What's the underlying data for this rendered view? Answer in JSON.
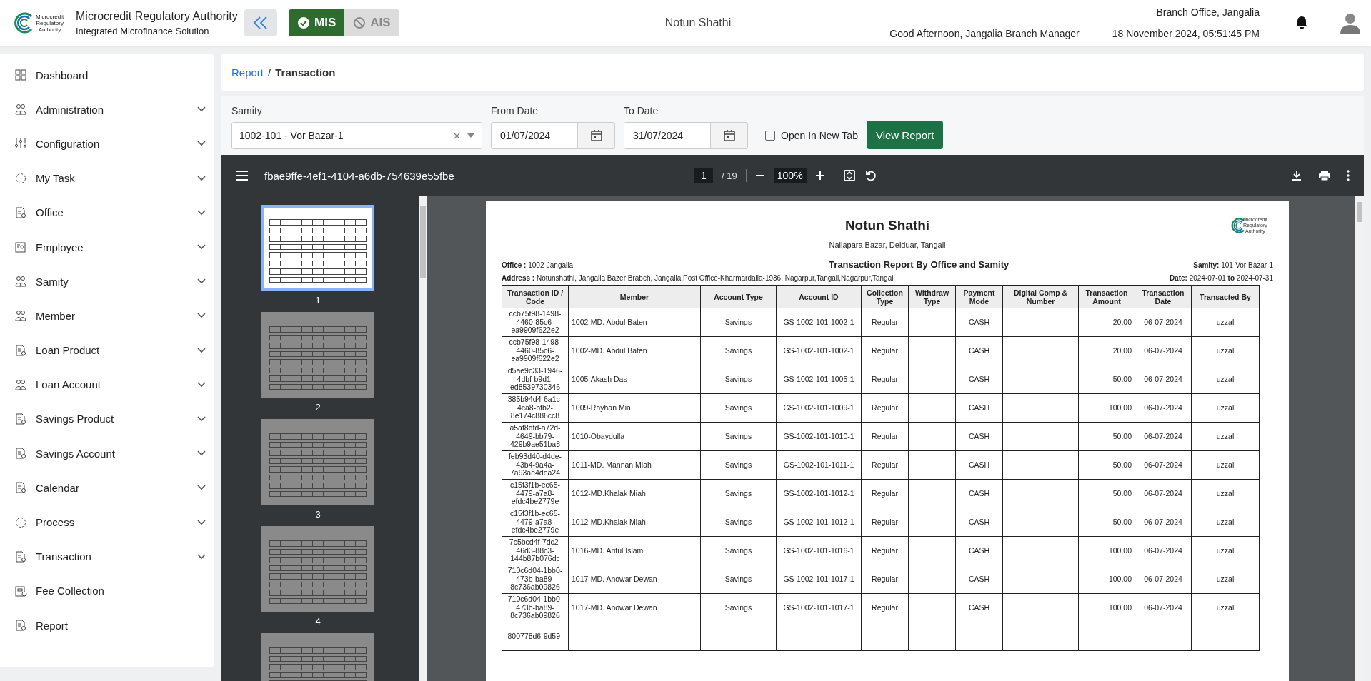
{
  "header": {
    "logo_text": [
      "Microcredit",
      "Regulatory",
      "Authority"
    ],
    "title": "Microcredit Regulatory Authority",
    "subtitle": "Integrated Microfinance Solution",
    "modes": [
      {
        "label": "MIS",
        "selected": true,
        "disabled": false
      },
      {
        "label": "AIS",
        "selected": false,
        "disabled": true
      }
    ],
    "org_name": "Notun Shathi",
    "branch": "Branch Office, Jangalia",
    "greeting": "Good Afternoon, Jangalia Branch Manager",
    "datetime": "18 November 2024, 05:51:45 PM"
  },
  "sidebar": {
    "items": [
      {
        "label": "Dashboard",
        "has_submenu": false
      },
      {
        "label": "Administration",
        "has_submenu": true
      },
      {
        "label": "Configuration",
        "has_submenu": true
      },
      {
        "label": "My Task",
        "has_submenu": true
      },
      {
        "label": "Office",
        "has_submenu": true
      },
      {
        "label": "Employee",
        "has_submenu": true
      },
      {
        "label": "Samity",
        "has_submenu": true
      },
      {
        "label": "Member",
        "has_submenu": true
      },
      {
        "label": "Loan Product",
        "has_submenu": true
      },
      {
        "label": "Loan Account",
        "has_submenu": true
      },
      {
        "label": "Savings Product",
        "has_submenu": true
      },
      {
        "label": "Savings Account",
        "has_submenu": true
      },
      {
        "label": "Calendar",
        "has_submenu": true
      },
      {
        "label": "Process",
        "has_submenu": true
      },
      {
        "label": "Transaction",
        "has_submenu": true
      },
      {
        "label": "Fee Collection",
        "has_submenu": false
      },
      {
        "label": "Report",
        "has_submenu": false
      }
    ]
  },
  "breadcrumb": [
    {
      "label": "Report",
      "link": true
    },
    {
      "label": "Transaction",
      "link": false
    }
  ],
  "breadcrumb_separator": "/",
  "filters": {
    "samity": {
      "label": "Samity",
      "value": "1002-101 - Vor Bazar-1"
    },
    "from_date": {
      "label": "From Date",
      "value": "01/07/2024"
    },
    "to_date": {
      "label": "To Date",
      "value": "31/07/2024"
    },
    "open_in_new_tab": {
      "label": "Open In New Tab",
      "checked": false
    },
    "submit": "View Report"
  },
  "pdf_viewer": {
    "file_name": "fbae9ffe-4ef1-4104-a6db-754639e55fbe",
    "page": "1",
    "page_count": "/ 19",
    "zoom": "100%",
    "thumbnails": [
      {
        "label": "1",
        "selected": true
      },
      {
        "label": "2",
        "selected": false
      },
      {
        "label": "3",
        "selected": false
      },
      {
        "label": "4",
        "selected": false
      },
      {
        "selected": false
      }
    ],
    "document": {
      "title": "Notun Shathi",
      "address": "Nallapara Bazar, Delduar, Tangail",
      "logo_text": [
        "Microcredit",
        "Regulatory",
        "Authority"
      ],
      "office": "**Office :** 1002-Jangalia",
      "report_title": "Transaction Report By Office and Samity",
      "samity": "**Samity:** 101-Vor Bazar-1",
      "full_address": "**Address :** Notunshathi, Jangalia Bazer Brabch, Jangalia,Post Office-Kharmardalla-1936, Nagarpur,Tangail,Nagarpur,Tangail",
      "date_range": "**Date:** 2024-07-01 **to** 2024-07-31",
      "columns": [
        "Transaction ID / Code",
        "Member",
        "Account Type",
        "Account ID",
        "Collection Type",
        "Withdraw Type",
        "Payment Mode",
        "Digital Comp & Number",
        "Transaction Amount",
        "Transaction Date",
        "Transacted By"
      ],
      "rows": [
        {
          "id": "ccb75f98-1498-4460-85c6-ea9909f622e2",
          "member": "1002-MD. Abdul Baten",
          "account_type": "Savings",
          "account_id": "GS-1002-101-1002-1",
          "collection_type": "Regular",
          "payment_mode": "CASH",
          "amount": "20.00",
          "date": "06-07-2024",
          "by": "uzzal"
        },
        {
          "id": "ccb75f98-1498-4460-85c6-ea9909f622e2",
          "member": "1002-MD. Abdul Baten",
          "account_type": "Savings",
          "account_id": "GS-1002-101-1002-1",
          "collection_type": "Regular",
          "payment_mode": "CASH",
          "amount": "20.00",
          "date": "06-07-2024",
          "by": "uzzal"
        },
        {
          "id": "d5ae9c33-1946-4dbf-b9d1-ed8539730346",
          "member": "1005-Akash Das",
          "account_type": "Savings",
          "account_id": "GS-1002-101-1005-1",
          "collection_type": "Regular",
          "payment_mode": "CASH",
          "amount": "50.00",
          "date": "06-07-2024",
          "by": "uzzal"
        },
        {
          "id": "385b94d4-6a1c-4ca8-bfb2-8e174c886cc8",
          "member": "1009-Rayhan Mia",
          "account_type": "Savings",
          "account_id": "GS-1002-101-1009-1",
          "collection_type": "Regular",
          "payment_mode": "CASH",
          "amount": "100.00",
          "date": "06-07-2024",
          "by": "uzzal"
        },
        {
          "id": "a5af8dfd-a72d-4649-bb79-429b9ae51ba8",
          "member": "1010-Obaydulla",
          "account_type": "Savings",
          "account_id": "GS-1002-101-1010-1",
          "collection_type": "Regular",
          "payment_mode": "CASH",
          "amount": "50.00",
          "date": "06-07-2024",
          "by": "uzzal"
        },
        {
          "id": "feb93d40-d4de-43b4-9a4a-7a93ae4dea24",
          "member": "1011-MD. Mannan Miah",
          "account_type": "Savings",
          "account_id": "GS-1002-101-1011-1",
          "collection_type": "Regular",
          "payment_mode": "CASH",
          "amount": "50.00",
          "date": "06-07-2024",
          "by": "uzzal"
        },
        {
          "id": "c15f3f1b-ec65-4479-a7a8-efdc4be2779e",
          "member": "1012-MD.Khalak Miah",
          "account_type": "Savings",
          "account_id": "GS-1002-101-1012-1",
          "collection_type": "Regular",
          "payment_mode": "CASH",
          "amount": "50.00",
          "date": "06-07-2024",
          "by": "uzzal"
        },
        {
          "id": "c15f3f1b-ec65-4479-a7a8-efdc4be2779e",
          "member": "1012-MD.Khalak Miah",
          "account_type": "Savings",
          "account_id": "GS-1002-101-1012-1",
          "collection_type": "Regular",
          "payment_mode": "CASH",
          "amount": "50.00",
          "date": "06-07-2024",
          "by": "uzzal"
        },
        {
          "id": "7c5bcd4f-7dc2-46d3-88c3-144b87b076dc",
          "member": "1016-MD. Ariful Islam",
          "account_type": "Savings",
          "account_id": "GS-1002-101-1016-1",
          "collection_type": "Regular",
          "payment_mode": "CASH",
          "amount": "100.00",
          "date": "06-07-2024",
          "by": "uzzal"
        },
        {
          "id": "710c6d04-1bb0-473b-ba89-8c736ab09826",
          "member": "1017-MD. Anowar Dewan",
          "account_type": "Savings",
          "account_id": "GS-1002-101-1017-1",
          "collection_type": "Regular",
          "payment_mode": "CASH",
          "amount": "100.00",
          "date": "06-07-2024",
          "by": "uzzal"
        },
        {
          "id": "710c6d04-1bb0-473b-ba89-8c736ab09826",
          "member": "1017-MD. Anowar Dewan",
          "account_type": "Savings",
          "account_id": "GS-1002-101-1017-1",
          "collection_type": "Regular",
          "payment_mode": "CASH",
          "amount": "100.00",
          "date": "06-07-2024",
          "by": "uzzal"
        },
        {
          "id": "800778d6-9d59-"
        }
      ]
    }
  }
}
